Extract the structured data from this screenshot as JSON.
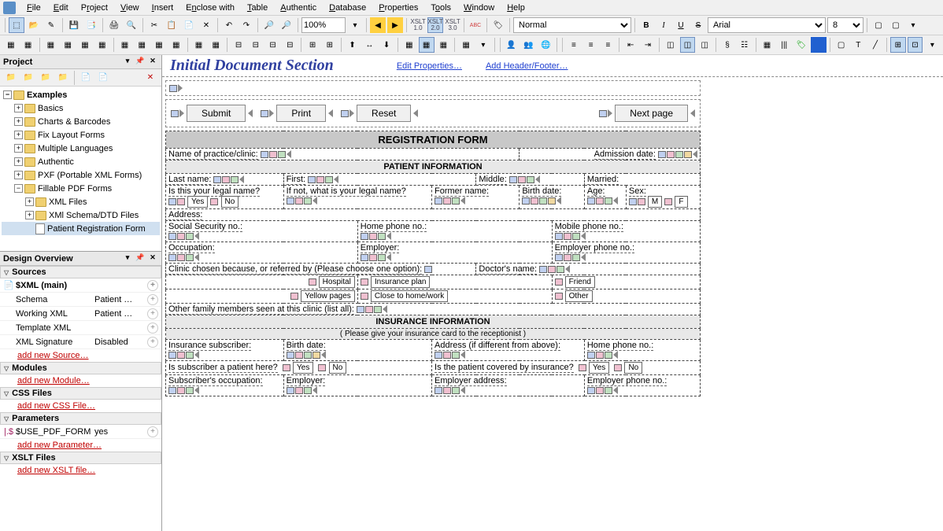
{
  "menu": [
    "File",
    "Edit",
    "Project",
    "View",
    "Insert",
    "Enclose with",
    "Table",
    "Authentic",
    "Database",
    "Properties",
    "Tools",
    "Window",
    "Help"
  ],
  "toolbar": {
    "zoom": "100%",
    "style_combo": "Normal",
    "font_combo": "Arial",
    "size_combo": "8",
    "xslt": [
      "XSLT 1.0",
      "XSLT 2.0",
      "XSLT 3.0"
    ],
    "abc": "ABC"
  },
  "project": {
    "title": "Project",
    "root": "Examples",
    "items": [
      {
        "label": "Basics",
        "depth": 1,
        "exp": "+"
      },
      {
        "label": "Charts & Barcodes",
        "depth": 1,
        "exp": "+"
      },
      {
        "label": "Fix Layout Forms",
        "depth": 1,
        "exp": "+"
      },
      {
        "label": "Multiple Languages",
        "depth": 1,
        "exp": "+"
      },
      {
        "label": "Authentic",
        "depth": 1,
        "exp": "+"
      },
      {
        "label": "PXF (Portable XML Forms)",
        "depth": 1,
        "exp": "+"
      },
      {
        "label": "Fillable PDF Forms",
        "depth": 1,
        "exp": "−"
      },
      {
        "label": "XML Files",
        "depth": 2,
        "exp": "+"
      },
      {
        "label": "XMl Schema/DTD Files",
        "depth": 2,
        "exp": "+"
      },
      {
        "label": "Patient Registration Form",
        "depth": 2,
        "icon": "file",
        "selected": true
      }
    ]
  },
  "overview": {
    "title": "Design Overview",
    "sections": {
      "sources": {
        "title": "Sources",
        "main": "$XML (main)",
        "rows": [
          {
            "k": "Schema",
            "v": "Patient …"
          },
          {
            "k": "Working XML",
            "v": "Patient …"
          },
          {
            "k": "Template XML",
            "v": ""
          },
          {
            "k": "XML Signature",
            "v": "Disabled"
          }
        ],
        "add": "add new Source…"
      },
      "modules": {
        "title": "Modules",
        "add": "add new Module…"
      },
      "css": {
        "title": "CSS Files",
        "add": "add new CSS File…"
      },
      "params": {
        "title": "Parameters",
        "rows": [
          {
            "k": "$USE_PDF_FORM",
            "v": "yes"
          }
        ],
        "add": "add new Parameter…"
      },
      "xslt": {
        "title": "XSLT Files",
        "add": "add new XSLT file…"
      }
    }
  },
  "doc": {
    "title": "Initial Document Section",
    "links": [
      "Edit Properties…",
      "Add Header/Footer…"
    ],
    "buttons": [
      "Submit",
      "Print",
      "Reset",
      "Next page"
    ],
    "sections": {
      "reg": "REGISTRATION FORM",
      "patient": "PATIENT INFORMATION",
      "insurance": "INSURANCE INFORMATION",
      "insurance_note": "( Please give your insurance card to the receptionist )"
    },
    "fields": {
      "practice": "Name of practice/clinic:",
      "admission": "Admission date:",
      "lastname": "Last name:",
      "first": "First:",
      "middle": "Middle:",
      "married": "Married:",
      "legal_q": "Is this your legal name?",
      "yes": "Yes",
      "no": "No",
      "legal_if": "If not, what is your legal name?",
      "former": "Former name:",
      "birth": "Birth date:",
      "age": "Age:",
      "sex": "Sex:",
      "m": "M",
      "f": "F",
      "address": "Address:",
      "ssn": "Social Security no.:",
      "homephone": "Home phone no.:",
      "mobile": "Mobile phone no.:",
      "occupation": "Occupation:",
      "employer": "Employer:",
      "empphone": "Employer phone no.:",
      "referred": "Clinic chosen because, or referred by (Please choose one option):",
      "doctor": "Doctor's name:",
      "hospital": "Hospital",
      "insplan": "Insurance plan",
      "friend": "Friend",
      "yellow": "Yellow pages",
      "close": "Close to home/work",
      "other": "Other",
      "family": "Other family members seen at this clinic (list all):",
      "ins_sub": "Insurance subscriber:",
      "ins_birth": "Birth date:",
      "ins_addr": "Address (if different from above):",
      "ins_home": "Home phone no.:",
      "sub_patient": "Is subscriber a patient here?",
      "covered": "Is the patient covered by insurance?",
      "sub_occ": "Subscriber's occupation:",
      "sub_emp": "Employer:",
      "sub_empaddr": "Employer address:",
      "sub_empphone": "Employer phone no.:"
    }
  }
}
